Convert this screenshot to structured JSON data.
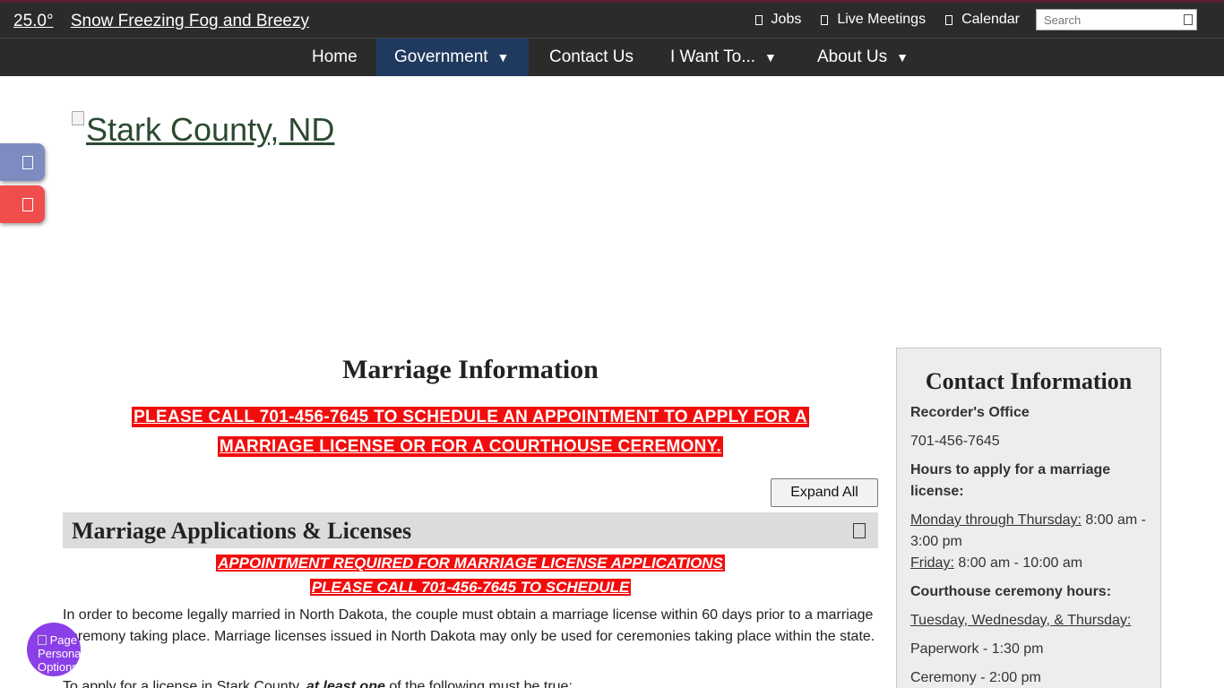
{
  "weather": {
    "temp": "25.0°",
    "condition": "Snow Freezing Fog and Breezy"
  },
  "utility": {
    "links": [
      "Jobs",
      "Live Meetings",
      "Calendar"
    ],
    "search_placeholder": "Search"
  },
  "nav": [
    {
      "label": "Home",
      "has_menu": false
    },
    {
      "label": "Government",
      "has_menu": true,
      "active": true
    },
    {
      "label": "Contact Us",
      "has_menu": false
    },
    {
      "label": "I Want To...",
      "has_menu": true
    },
    {
      "label": "About Us",
      "has_menu": true
    }
  ],
  "caret": "▼",
  "logo": {
    "alt_text": "Stark County, ND"
  },
  "main": {
    "title": "Marriage Information",
    "alert_line1": "PLEASE CALL 701-456-7645 TO SCHEDULE AN APPOINTMENT TO APPLY FOR A",
    "alert_line2": "MARRIAGE LICENSE OR FOR A COURTHOUSE CEREMONY.",
    "expand_label": "Expand All",
    "accordion_title": "Marriage Applications & Licenses",
    "req_line1": "APPOINTMENT REQUIRED FOR MARRIAGE LICENSE APPLICATIONS",
    "req_line2": "PLEASE CALL 701-456-7645 TO SCHEDULE",
    "paragraph1": "In order to become legally married in North Dakota, the couple must obtain a marriage license within 60 days prior to a marriage ceremony taking place. Marriage licenses issued in North Dakota may only be used for ceremonies taking place within the state.",
    "paragraph2_pre": "To apply for a license in Stark County,",
    "paragraph2_em": "at least one",
    "paragraph2_post": "of the following must be true:"
  },
  "sidebar": {
    "title": "Contact Information",
    "office": "Recorder's Office",
    "phone": "701-456-7645",
    "hours_label": "Hours to apply for a marriage license:",
    "mon_thu_label": "Monday through Thursday:",
    "mon_thu_hours": "8:00 am - 3:00 pm",
    "fri_label": "Friday:",
    "fri_hours": "8:00 am - 10:00 am",
    "ceremony_label": "Courthouse ceremony hours:",
    "ceremony_days": "Tuesday, Wednesday, & Thursday:",
    "paperwork": "Paperwork - 1:30 pm",
    "ceremony": "Ceremony - 2:00 pm"
  },
  "persona": {
    "text": "Page Personalization Options"
  },
  "colors": {
    "topbar": "#2b2b2b",
    "nav_active": "#1f3a5e",
    "alert_red": "#f20d0d",
    "float_blue": "#7d8bc0",
    "float_red": "#f04d4d",
    "persona_purple": "#8b3fe8"
  }
}
